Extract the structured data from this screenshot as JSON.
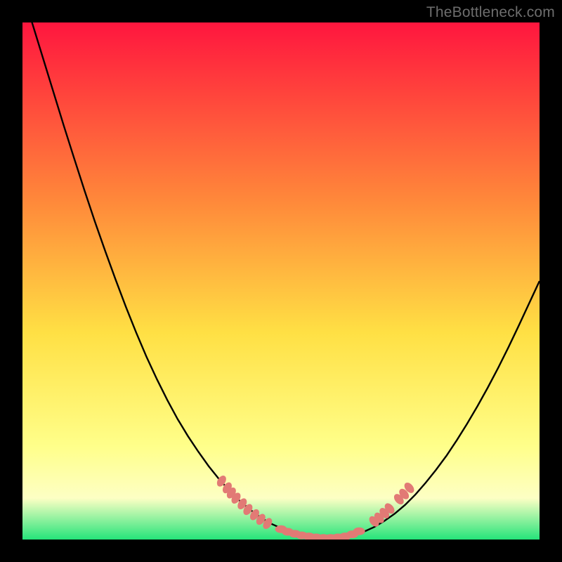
{
  "attribution": "TheBottleneck.com",
  "colors": {
    "frame_bg": "#000000",
    "gradient_top": "#ff163e",
    "gradient_mid_upper": "#ff8a3a",
    "gradient_mid": "#ffe044",
    "gradient_lower": "#ffff8a",
    "gradient_band": "#fdffc4",
    "gradient_bottom": "#25e47a",
    "curve_stroke": "#000000",
    "marker_fill": "#e27a75",
    "marker_stroke": "#b85a55"
  },
  "chart_data": {
    "type": "line",
    "title": "",
    "xlabel": "",
    "ylabel": "",
    "xlim": [
      0,
      100
    ],
    "ylim": [
      0,
      100
    ],
    "x": [
      0,
      2,
      4,
      6,
      8,
      10,
      12,
      14,
      16,
      18,
      20,
      22,
      24,
      26,
      28,
      30,
      32,
      34,
      36,
      38,
      40,
      42,
      44,
      46,
      48,
      50,
      52,
      54,
      56,
      58,
      60,
      62,
      64,
      66,
      68,
      70,
      72,
      74,
      76,
      78,
      80,
      82,
      84,
      86,
      88,
      90,
      92,
      94,
      96,
      98,
      100
    ],
    "y": [
      106,
      99.5,
      93,
      86.5,
      80,
      73.7,
      67.5,
      61.5,
      55.8,
      50.3,
      45,
      40,
      35.3,
      31,
      27,
      23.3,
      20,
      17,
      14.2,
      11.7,
      9.5,
      7.5,
      5.8,
      4.3,
      3.1,
      2.2,
      1.4,
      0.9,
      0.5,
      0.3,
      0.3,
      0.5,
      0.9,
      1.5,
      2.4,
      3.6,
      5,
      6.7,
      8.7,
      11,
      13.5,
      16.2,
      19.2,
      22.4,
      25.8,
      29.4,
      33.2,
      37.2,
      41.4,
      45.7,
      50
    ],
    "markers": {
      "left_arm": [
        {
          "x": 38.5,
          "y": 11.3
        },
        {
          "x": 39.6,
          "y": 10.0
        },
        {
          "x": 40.4,
          "y": 9.0
        },
        {
          "x": 41.3,
          "y": 8.0
        },
        {
          "x": 42.5,
          "y": 6.9
        },
        {
          "x": 43.6,
          "y": 5.8
        },
        {
          "x": 44.9,
          "y": 4.8
        },
        {
          "x": 46.1,
          "y": 3.9
        },
        {
          "x": 47.4,
          "y": 3.1
        }
      ],
      "bottom": [
        {
          "x": 50.0,
          "y": 2.0
        },
        {
          "x": 51.3,
          "y": 1.5
        },
        {
          "x": 52.7,
          "y": 1.1
        },
        {
          "x": 54.0,
          "y": 0.8
        },
        {
          "x": 55.4,
          "y": 0.6
        },
        {
          "x": 56.8,
          "y": 0.4
        },
        {
          "x": 58.2,
          "y": 0.3
        },
        {
          "x": 59.6,
          "y": 0.3
        },
        {
          "x": 61.0,
          "y": 0.4
        },
        {
          "x": 62.4,
          "y": 0.6
        },
        {
          "x": 63.8,
          "y": 1.0
        },
        {
          "x": 65.1,
          "y": 1.6
        }
      ],
      "right_arm": [
        {
          "x": 68.0,
          "y": 3.5
        },
        {
          "x": 69.0,
          "y": 4.2
        },
        {
          "x": 70.0,
          "y": 5.1
        },
        {
          "x": 71.0,
          "y": 6.0
        },
        {
          "x": 72.8,
          "y": 7.8
        },
        {
          "x": 73.8,
          "y": 8.8
        },
        {
          "x": 74.8,
          "y": 10.0
        }
      ]
    }
  }
}
